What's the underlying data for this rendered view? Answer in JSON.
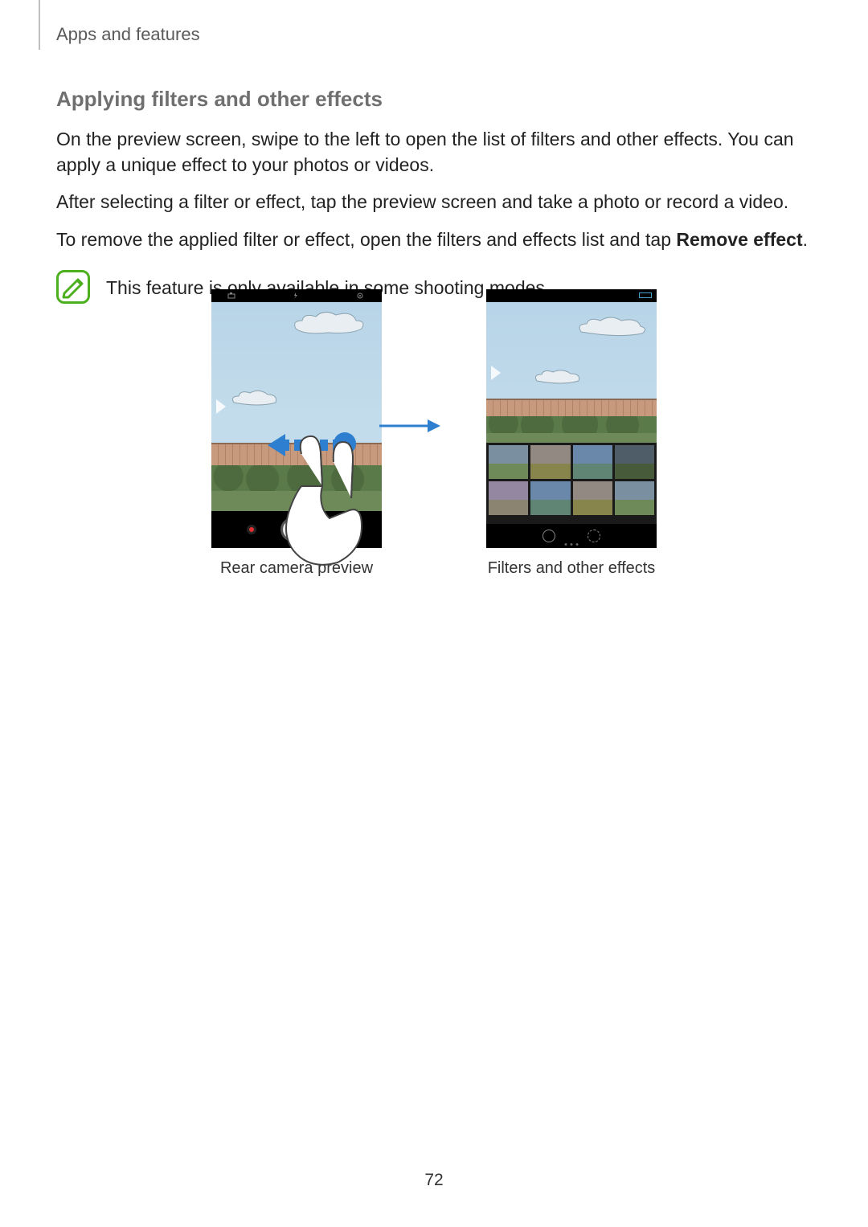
{
  "header": {
    "breadcrumb": "Apps and features"
  },
  "section": {
    "heading": "Applying filters and other effects",
    "p1": "On the preview screen, swipe to the left to open the list of filters and other effects. You can apply a unique effect to your photos or videos.",
    "p2": "After selecting a filter or effect, tap the preview screen and take a photo or record a video.",
    "p3_prefix": "To remove the applied filter or effect, open the filters and effects list and tap ",
    "p3_strong": "Remove effect",
    "p3_suffix": ".",
    "note": "This feature is only available in some shooting modes."
  },
  "figures": {
    "left_caption": "Rear camera preview",
    "right_caption": "Filters and other effects"
  },
  "colors": {
    "note_accent": "#4caf1d",
    "swipe_accent": "#2f7fd1"
  },
  "page_number": "72"
}
